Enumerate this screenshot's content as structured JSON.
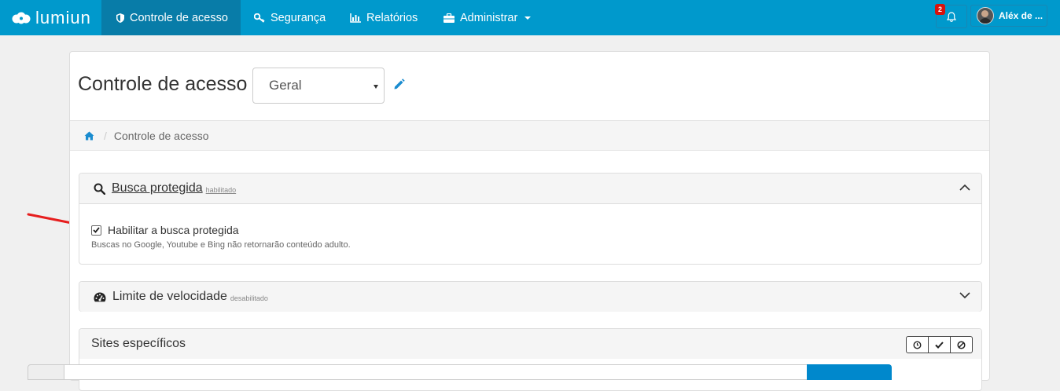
{
  "navbar": {
    "brand": "lumiun",
    "items": [
      {
        "label": "Controle de acesso",
        "icon": "shield-icon",
        "active": true
      },
      {
        "label": "Segurança",
        "icon": "key-icon"
      },
      {
        "label": "Relatórios",
        "icon": "bar-chart-icon"
      },
      {
        "label": "Administrar",
        "icon": "briefcase-icon"
      }
    ],
    "notifications_count": "2",
    "user_name": "Aléx de ..."
  },
  "page": {
    "title": "Controle de acesso",
    "profile_selected": "Geral"
  },
  "breadcrumb": {
    "current": "Controle de acesso"
  },
  "panels": {
    "safe_search": {
      "title": "Busca protegida",
      "status": "habilitado",
      "checkbox_label": "Habilitar a busca protegida",
      "checked": true,
      "help": "Buscas no Google, Youtube e Bing não retornarão conteúdo adulto."
    },
    "speed_limit": {
      "title": "Limite de velocidade",
      "status": "desabilitado"
    },
    "specific_sites": {
      "title": "Sites específicos"
    }
  },
  "colors": {
    "navbar": "#0099cc",
    "navbar_active": "#087ca8",
    "accent": "#1a8ccf",
    "arrow": "#e61e1e"
  }
}
